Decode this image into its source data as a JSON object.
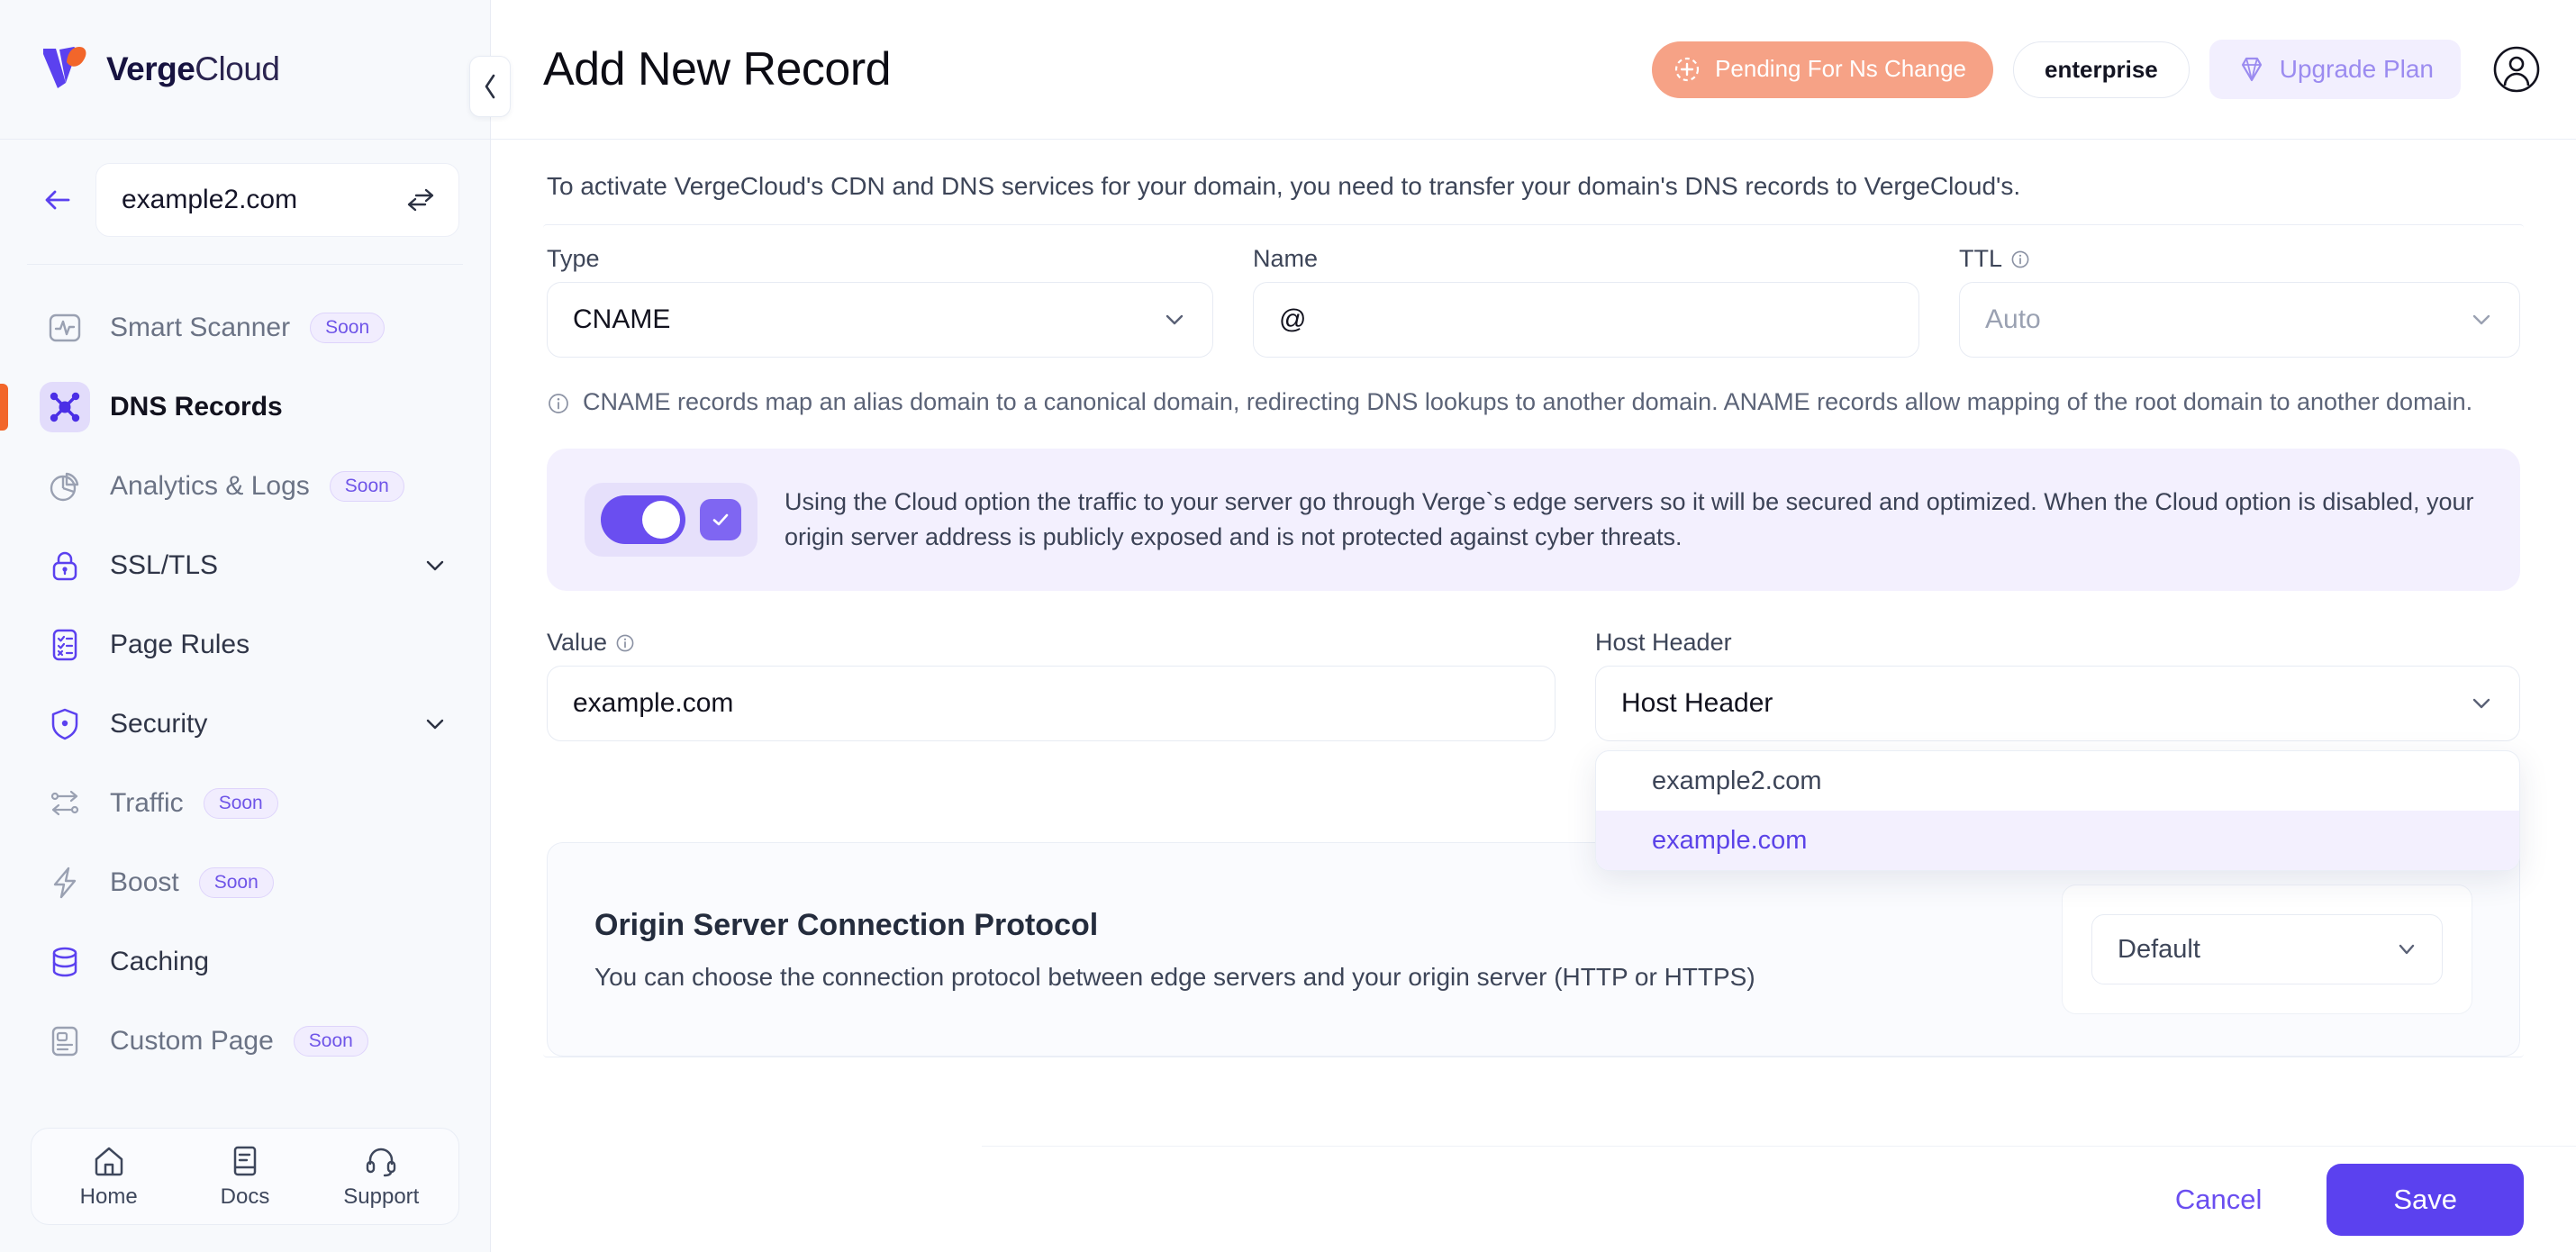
{
  "brand": {
    "name_bold": "Verge",
    "name_light": "Cloud"
  },
  "sidebar": {
    "domain": {
      "value": "example2.com",
      "swap_icon": "swap-arrows-icon",
      "back_icon": "back-arrow-icon"
    },
    "items": [
      {
        "label": "Smart Scanner",
        "badge": "Soon",
        "icon": "pulse-monitor-icon",
        "state": "soon"
      },
      {
        "label": "DNS Records",
        "badge": "",
        "icon": "dns-nodes-icon",
        "state": "active"
      },
      {
        "label": "Analytics & Logs",
        "badge": "Soon",
        "icon": "pie-chart-icon",
        "state": "soon"
      },
      {
        "label": "SSL/TLS",
        "badge": "",
        "icon": "lock-icon",
        "state": "expandable"
      },
      {
        "label": "Page Rules",
        "badge": "",
        "icon": "rules-document-icon",
        "state": "normal"
      },
      {
        "label": "Security",
        "badge": "",
        "icon": "shield-icon",
        "state": "expandable"
      },
      {
        "label": "Traffic",
        "badge": "Soon",
        "icon": "traffic-routes-icon",
        "state": "soon"
      },
      {
        "label": "Boost",
        "badge": "Soon",
        "icon": "lightning-bolt-icon",
        "state": "soon"
      },
      {
        "label": "Caching",
        "badge": "",
        "icon": "database-icon",
        "state": "normal"
      },
      {
        "label": "Custom Page",
        "badge": "Soon",
        "icon": "custom-page-icon",
        "state": "soon"
      }
    ],
    "footer": [
      {
        "label": "Home",
        "icon": "home-icon"
      },
      {
        "label": "Docs",
        "icon": "book-icon"
      },
      {
        "label": "Support",
        "icon": "headset-icon"
      }
    ]
  },
  "header": {
    "title": "Add New Record",
    "status_badge": "Pending For Ns Change",
    "plan_badge": "enterprise",
    "upgrade_label": "Upgrade Plan",
    "status_color": "#f6a286",
    "accent_color": "#5b41ef"
  },
  "main": {
    "intro": "To activate VergeCloud's CDN and DNS services for your domain, you need to transfer your domain's DNS records to VergeCloud's.",
    "type_label": "Type",
    "type_value": "CNAME",
    "name_label": "Name",
    "name_value": "@",
    "ttl_label": "TTL",
    "ttl_value": "Auto",
    "record_note": "CNAME records map an alias domain to a canonical domain, redirecting DNS lookups to another domain. ANAME records allow mapping of the root domain to another domain.",
    "cloud_text": "Using the Cloud option the traffic to your server go through Verge`s edge servers so it will be secured and optimized. When the Cloud option is disabled, your origin server address is publicly exposed and is not protected against cyber threats.",
    "value_label": "Value",
    "value_value": "example.com",
    "hostheader_label": "Host Header",
    "hostheader_value": "Host Header",
    "hostheader_options": [
      {
        "label": "example2.com",
        "selected": false
      },
      {
        "label": "example.com",
        "selected": true
      }
    ],
    "protocol_title": "Origin Server Connection Protocol",
    "protocol_sub": "You can choose the connection protocol between edge servers and your origin server (HTTP or HTTPS)",
    "protocol_value": "Default"
  },
  "footer": {
    "cancel_label": "Cancel",
    "save_label": "Save"
  }
}
